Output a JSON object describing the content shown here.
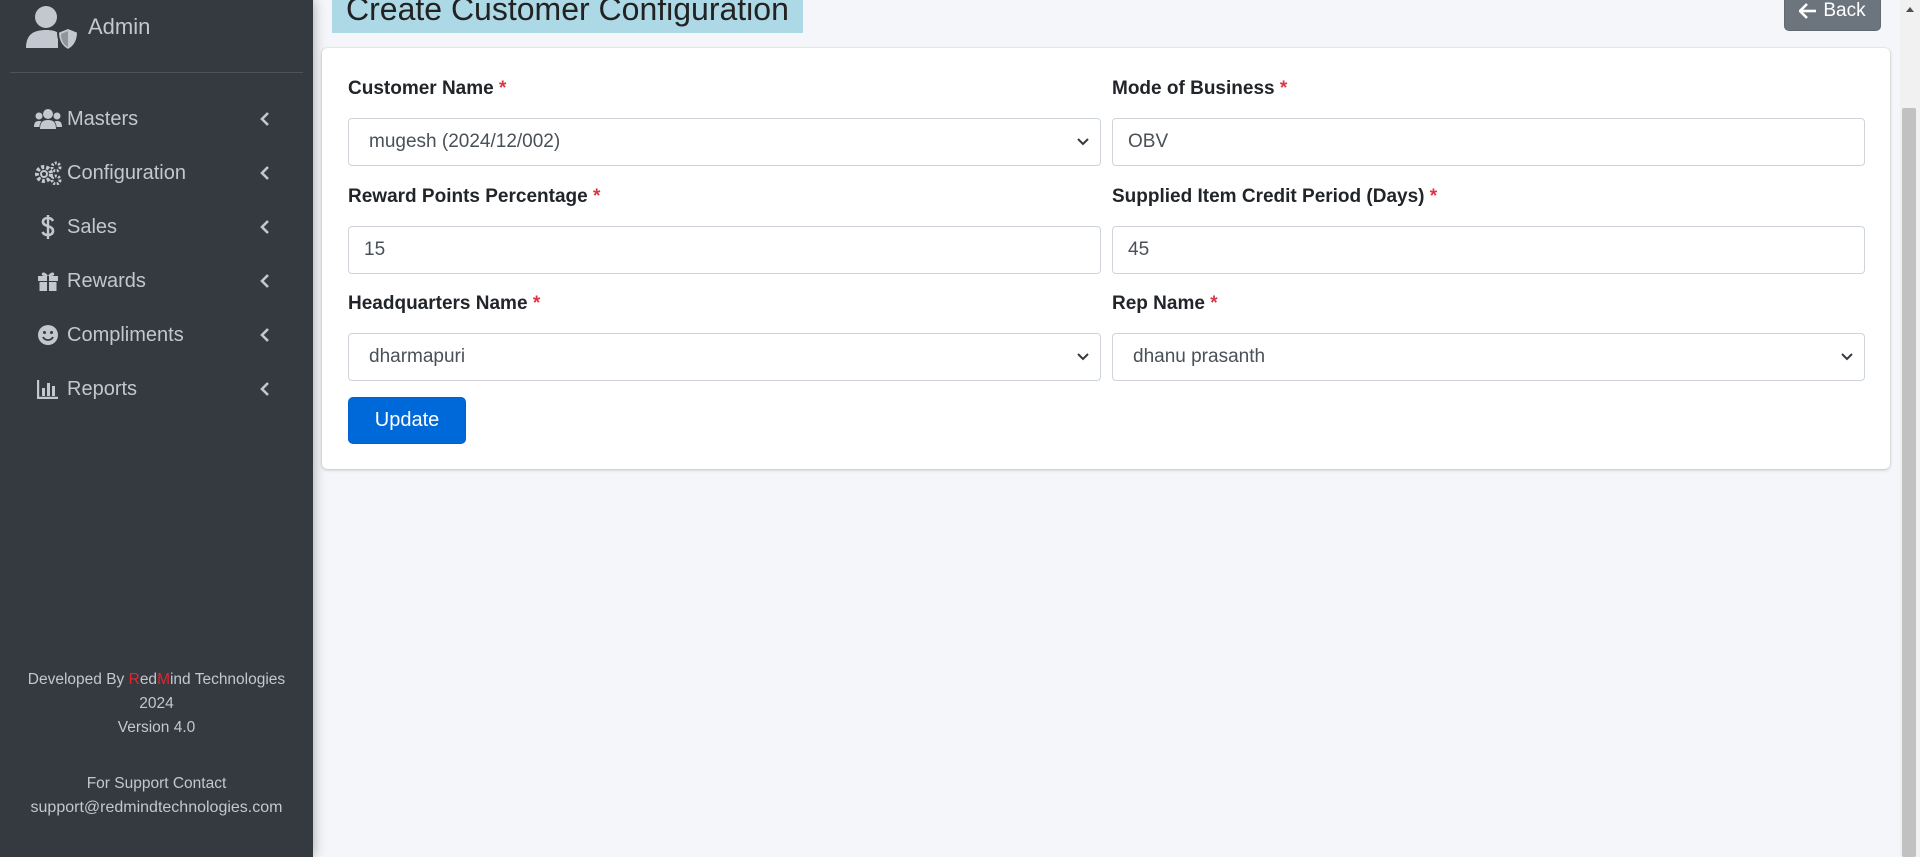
{
  "sidebar": {
    "brand": "Admin",
    "items": [
      {
        "label": "Masters",
        "icon": "users-icon"
      },
      {
        "label": "Configuration",
        "icon": "cogs-icon"
      },
      {
        "label": "Sales",
        "icon": "dollar-icon"
      },
      {
        "label": "Rewards",
        "icon": "gift-icon"
      },
      {
        "label": "Compliments",
        "icon": "smile-icon"
      },
      {
        "label": "Reports",
        "icon": "bar-chart-icon"
      }
    ],
    "footer": {
      "developed_prefix": "Developed By ",
      "company_r": "R",
      "company_ed": "ed",
      "company_m": "M",
      "company_rest": "ind Technologies",
      "year": "2024",
      "version": "Version 4.0",
      "support_label": "For Support Contact",
      "support_email": "support@redmindtechnologies.com"
    }
  },
  "page": {
    "title": "Create Customer Configuration",
    "back_label": "Back"
  },
  "form": {
    "required_mark": "*",
    "customer_name": {
      "label": "Customer Name",
      "value": "mugesh (2024/12/002)"
    },
    "mode_of_business": {
      "label": "Mode of Business",
      "value": "OBV"
    },
    "reward_points": {
      "label": "Reward Points Percentage",
      "value": "15"
    },
    "credit_period": {
      "label": "Supplied Item Credit Period (Days)",
      "value": "45"
    },
    "headquarters": {
      "label": "Headquarters Name",
      "value": "dharmapuri"
    },
    "rep_name": {
      "label": "Rep Name",
      "value": "dhanu prasanth"
    },
    "update_label": "Update"
  },
  "colors": {
    "sidebar_bg": "#343a40",
    "title_highlight": "#add8e6",
    "primary": "#0069d9",
    "secondary": "#6c757d",
    "required": "#dc3545"
  }
}
